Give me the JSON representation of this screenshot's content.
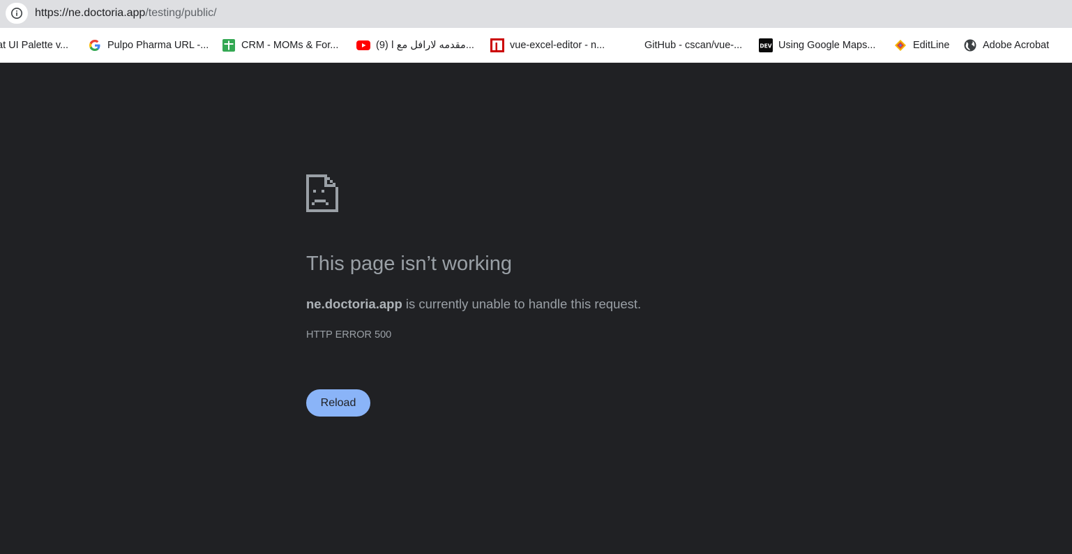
{
  "browser": {
    "url_host": "https://ne.doctoria.app",
    "url_path": "/testing/public/",
    "info_icon": "info-icon"
  },
  "bookmarks": [
    {
      "label": "at UI Palette v...",
      "icon": "none"
    },
    {
      "label": "Pulpo Pharma URL -...",
      "icon": "google-icon"
    },
    {
      "label": "CRM - MOMs & For...",
      "icon": "sheets-icon"
    },
    {
      "label": "(9) مقدمه لارافل مع ا...",
      "icon": "youtube-icon"
    },
    {
      "label": "vue-excel-editor - n...",
      "icon": "npm-icon"
    },
    {
      "label": "GitHub - cscan/vue-...",
      "icon": "none"
    },
    {
      "label": "Using Google Maps...",
      "icon": "dev-icon"
    },
    {
      "label": "EditLine",
      "icon": "editline-icon"
    },
    {
      "label": "Adobe Acrobat",
      "icon": "globe-icon"
    }
  ],
  "error_page": {
    "title": "This page isn’t working",
    "host": "ne.doctoria.app",
    "message": " is currently unable to handle this request.",
    "code": "HTTP ERROR 500",
    "reload_label": "Reload",
    "icon": "sad-page-icon"
  },
  "colors": {
    "background": "#202124",
    "text": "#9aa0a6",
    "button": "#8ab4f8"
  }
}
